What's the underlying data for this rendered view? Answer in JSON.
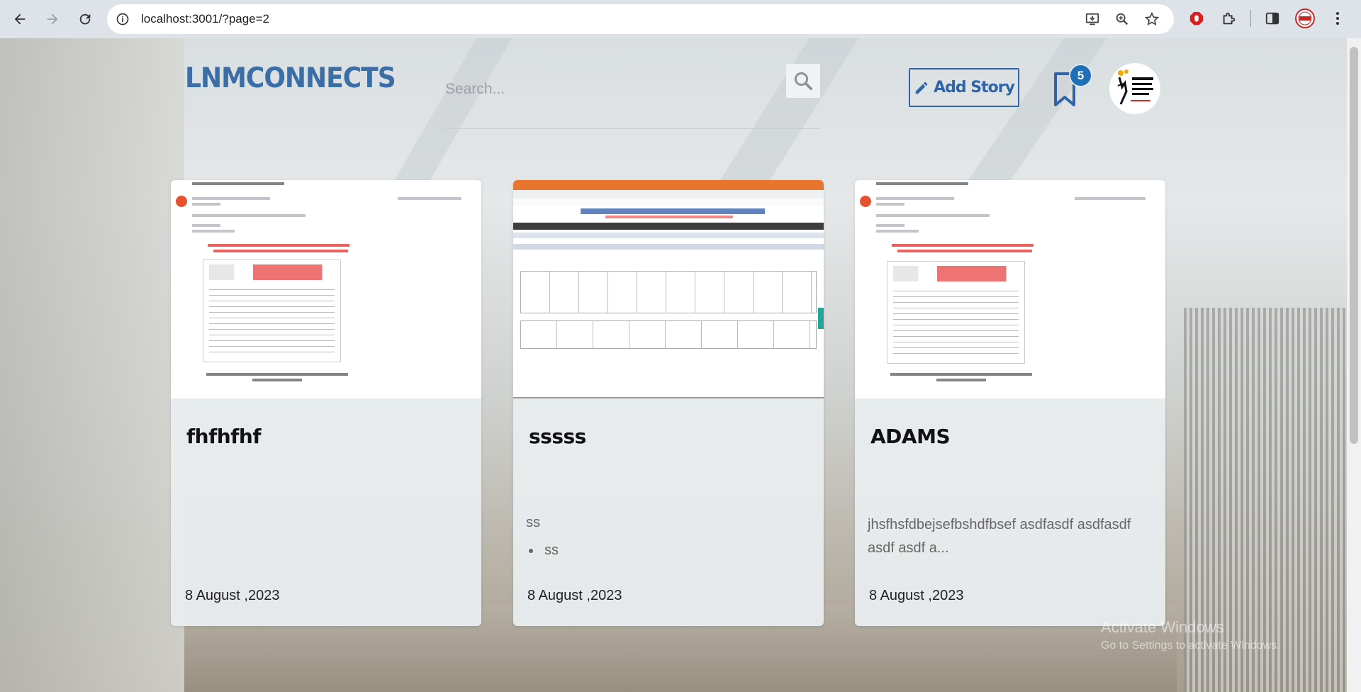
{
  "browser": {
    "url": "localhost:3001/?page=2"
  },
  "header": {
    "logo": "LNMCONNECTS",
    "search_placeholder": "Search...",
    "add_story_label": "Add Story",
    "bookmark_count": "5"
  },
  "cards": [
    {
      "title": "fhfhfhf",
      "description": "",
      "bullets": [],
      "date": "8 August ,2023",
      "thumbnail": "email-affidavit"
    },
    {
      "title": "sssss",
      "description": "ss",
      "bullets": [
        "ss"
      ],
      "date": "8 August ,2023",
      "thumbnail": "lnmiit-portal"
    },
    {
      "title": "ADAMS",
      "description": "jhsfhsfdbejsefbshdfbsef asdfasdf asdfasdf asdf asdf a...",
      "bullets": [],
      "date": "8 August ,2023",
      "thumbnail": "email-affidavit"
    }
  ],
  "os_watermark": {
    "line1": "Activate Windows",
    "line2": "Go to Settings to activate Windows."
  },
  "colors": {
    "brand": "#3a6ea5",
    "accent": "#2f65a8",
    "badge": "#1f6fb8"
  }
}
